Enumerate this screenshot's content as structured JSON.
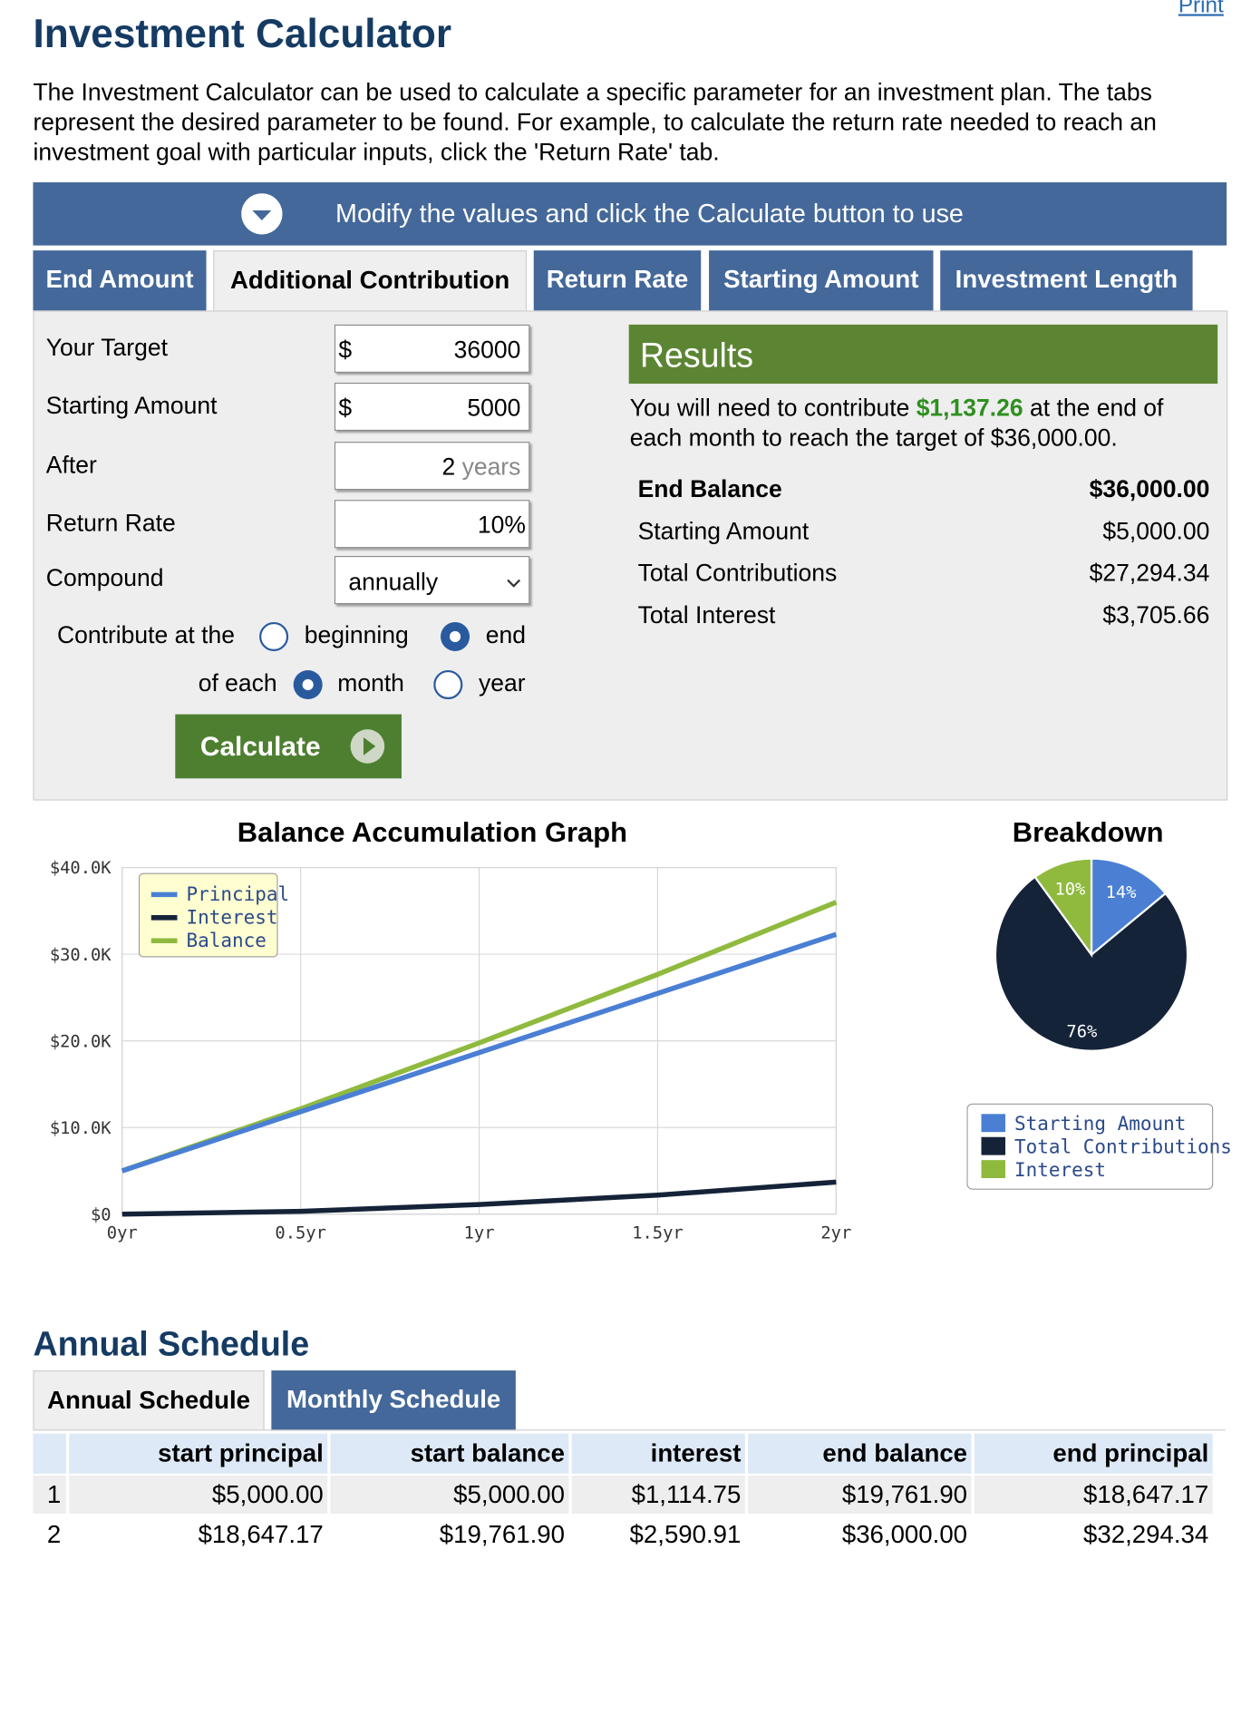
{
  "header": {
    "print_link": "Print",
    "title": "Investment Calculator",
    "intro": "The Investment Calculator can be used to calculate a specific parameter for an investment plan. The tabs represent the desired parameter to be found. For example, to calculate the return rate needed to reach an investment goal with particular inputs, click the 'Return Rate' tab."
  },
  "banner": {
    "text": "Modify the values and click the Calculate button to use",
    "icon": "chevron-down-circle-icon"
  },
  "tabs": [
    {
      "label": "End Amount",
      "active": false
    },
    {
      "label": "Additional Contribution",
      "active": true
    },
    {
      "label": "Return Rate",
      "active": false
    },
    {
      "label": "Starting Amount",
      "active": false
    },
    {
      "label": "Investment Length",
      "active": false
    }
  ],
  "form": {
    "target": {
      "label": "Your Target",
      "currency": "$",
      "value": "36000"
    },
    "starting": {
      "label": "Starting Amount",
      "currency": "$",
      "value": "5000"
    },
    "after": {
      "label": "After",
      "value": "2",
      "unit": "years"
    },
    "rate": {
      "label": "Return Rate",
      "value": "10",
      "unit": "%"
    },
    "compound": {
      "label": "Compound",
      "selected": "annually"
    },
    "contribute": {
      "label": "Contribute at the",
      "timing_options": [
        {
          "label": "beginning",
          "checked": false
        },
        {
          "label": "end",
          "checked": true
        }
      ],
      "period_label": "of each",
      "period_options": [
        {
          "label": "month",
          "checked": true
        },
        {
          "label": "year",
          "checked": false
        }
      ]
    },
    "calculate_label": "Calculate"
  },
  "results": {
    "title": "Results",
    "sentence_prefix": "You will need to contribute ",
    "contribution": "$1,137.26",
    "sentence_suffix": " at the end of each month to reach the target of $36,000.00.",
    "rows": [
      {
        "label": "End Balance",
        "value": "$36,000.00",
        "bold": true
      },
      {
        "label": "Starting Amount",
        "value": "$5,000.00",
        "bold": false
      },
      {
        "label": "Total Contributions",
        "value": "$27,294.34",
        "bold": false
      },
      {
        "label": "Total Interest",
        "value": "$3,705.66",
        "bold": false
      }
    ]
  },
  "chart_data": [
    {
      "type": "line",
      "title": "Balance Accumulation Graph",
      "x": [
        0,
        0.5,
        1,
        1.5,
        2
      ],
      "x_tick_labels": [
        "0yr",
        "0.5yr",
        "1yr",
        "1.5yr",
        "2yr"
      ],
      "y_tick_labels": [
        "$0",
        "$10.0K",
        "$20.0K",
        "$30.0K",
        "$40.0K"
      ],
      "ylim": [
        0,
        40000
      ],
      "xlim": [
        0,
        2
      ],
      "grid": true,
      "legend_position": "top-left",
      "series": [
        {
          "name": "Principal",
          "color": "#4a7fd4",
          "values": [
            5000,
            11824,
            18647,
            25471,
            32294
          ]
        },
        {
          "name": "Interest",
          "color": "#152339",
          "values": [
            0,
            330,
            1115,
            2200,
            3706
          ]
        },
        {
          "name": "Balance",
          "color": "#8fba3e",
          "values": [
            5000,
            12154,
            19762,
            27671,
            36000
          ]
        }
      ]
    },
    {
      "type": "pie",
      "title": "Breakdown",
      "legend_position": "bottom",
      "slices": [
        {
          "name": "Starting Amount",
          "value": 14,
          "label": "14%",
          "color": "#4a7fd4"
        },
        {
          "name": "Total Contributions",
          "value": 76,
          "label": "76%",
          "color": "#152339"
        },
        {
          "name": "Interest",
          "value": 10,
          "label": "10%",
          "color": "#8fba3e"
        }
      ]
    }
  ],
  "schedule": {
    "title": "Annual Schedule",
    "tabs": [
      {
        "label": "Annual Schedule",
        "active": true
      },
      {
        "label": "Monthly Schedule",
        "active": false
      }
    ],
    "columns": [
      "",
      "start principal",
      "start balance",
      "interest",
      "end balance",
      "end principal"
    ],
    "rows": [
      [
        "1",
        "$5,000.00",
        "$5,000.00",
        "$1,114.75",
        "$19,761.90",
        "$18,647.17"
      ],
      [
        "2",
        "$18,647.17",
        "$19,761.90",
        "$2,590.91",
        "$36,000.00",
        "$32,294.34"
      ]
    ]
  },
  "colors": {
    "navy": "#153b63",
    "tab_blue": "#44689a",
    "green_button": "#4e7f31",
    "results_green": "#5c8533"
  }
}
